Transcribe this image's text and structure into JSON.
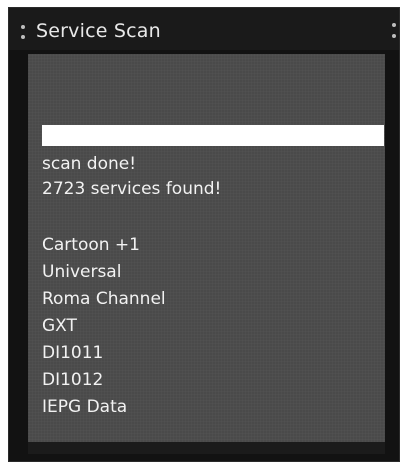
{
  "window": {
    "title": "Service Scan"
  },
  "scan": {
    "progress": 1.0,
    "status": "scan done!",
    "summary": "2723 services found!"
  },
  "services": [
    "Cartoon +1",
    "Universal",
    "Roma Channel",
    "GXT",
    "DI1011",
    "DI1012",
    "IEPG Data"
  ],
  "colors": {
    "panel": "#4a4a4a",
    "frame": "#121212",
    "text": "#f2f2f2",
    "progress_fill": "#ffffff"
  }
}
